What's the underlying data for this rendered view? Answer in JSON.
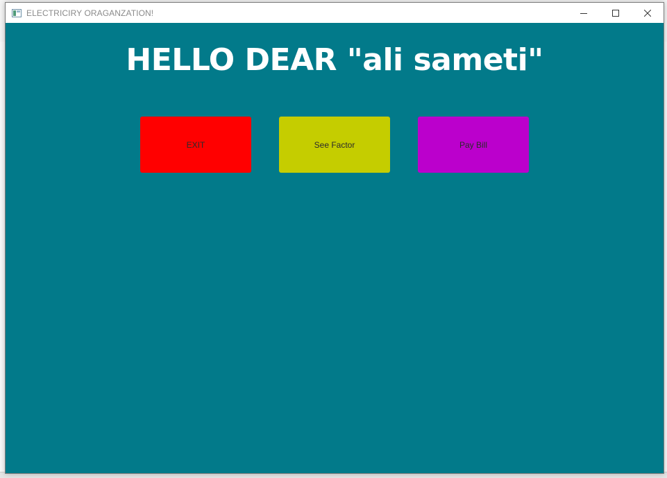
{
  "window": {
    "title": "ELECTRICIRY ORAGANZATION!",
    "app_icon": "java-window-icon",
    "controls": [
      "minimize-icon",
      "maximize-icon",
      "close-icon"
    ]
  },
  "main": {
    "greeting": "HELLO DEAR \"ali sameti\"",
    "background_color": "#027a8a",
    "buttons": [
      {
        "label": "EXIT",
        "color": "#ff0000"
      },
      {
        "label": "See Factor",
        "color": "#c5cd00"
      },
      {
        "label": "Pay Bill",
        "color": "#bb00cc"
      }
    ]
  }
}
